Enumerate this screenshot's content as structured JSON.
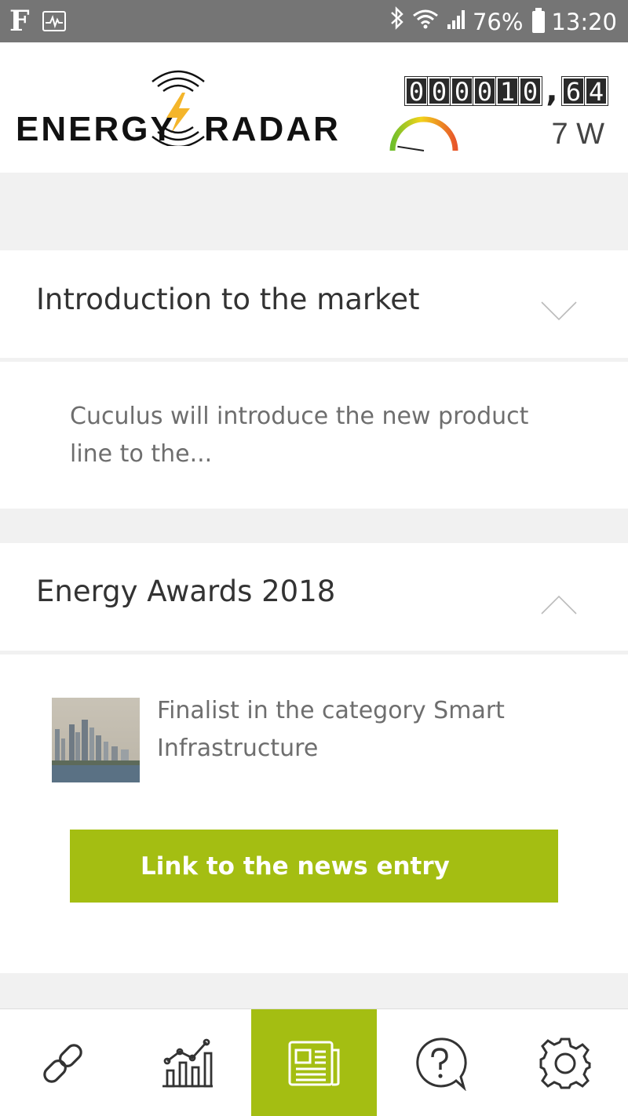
{
  "status_bar": {
    "left_glyph": "F",
    "battery": "76%",
    "time": "13:20",
    "icons": [
      "pulse-icon",
      "bluetooth-icon",
      "wifi-icon",
      "signal-icon",
      "battery-icon"
    ]
  },
  "header": {
    "logo_left": "ENERGY",
    "logo_right": "RADAR",
    "counter_digits": [
      "0",
      "0",
      "0",
      "0",
      "1",
      "0"
    ],
    "counter_separator": ",",
    "counter_decimals": [
      "6",
      "4"
    ],
    "power": "7 W",
    "gauge_level": 0.05
  },
  "cards": [
    {
      "title": "Introduction to the market",
      "body_line1": "Cuculus will introduce the new product",
      "body_line2": "line to the...",
      "expanded": false
    },
    {
      "title": "Energy Awards 2018",
      "body_line1": "Finalist in the category Smart",
      "body_line2": "Infrastructure",
      "expanded": true,
      "link_label": "Link to the news entry"
    }
  ],
  "nav": {
    "items": [
      {
        "icon": "link-icon",
        "active": false
      },
      {
        "icon": "chart-icon",
        "active": false
      },
      {
        "icon": "news-icon",
        "active": true
      },
      {
        "icon": "help-icon",
        "active": false
      },
      {
        "icon": "gear-icon",
        "active": false
      }
    ]
  },
  "colors": {
    "accent": "#a4be12",
    "status_bar": "#757575",
    "page_bg": "#f1f1f1"
  }
}
